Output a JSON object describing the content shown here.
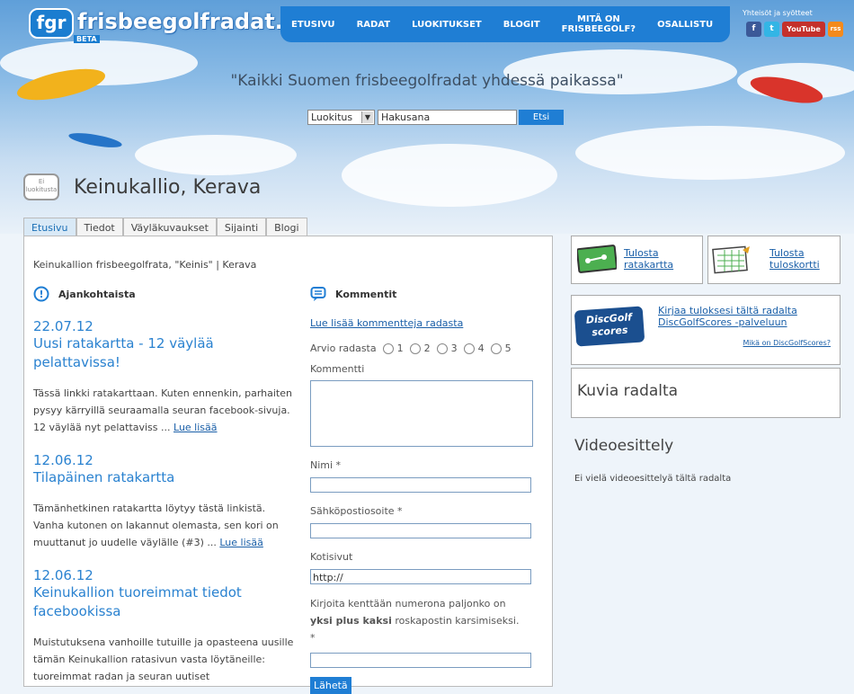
{
  "header": {
    "logo_short": "fgr",
    "logo_text": "frisbeegolfradat.fi",
    "logo_beta": "BETA",
    "nav": [
      "ETUSIVU",
      "RADAT",
      "LUOKITUKSET",
      "BLOGIT",
      "MITÄ ON\nFRISBEEGOLF?",
      "OSALLISTU"
    ],
    "social_title": "Yhteisöt ja syötteet",
    "social": [
      "f",
      "t",
      "YouTube",
      "rss"
    ],
    "tagline": "\"Kaikki Suomen frisbeegolfradat yhdessä paikassa\""
  },
  "search": {
    "select_value": "Luokitus",
    "input_placeholder": "Hakusana",
    "button": "Etsi"
  },
  "page": {
    "badge": "Ei luokitusta",
    "title": "Keinukallio, Kerava",
    "tabs": [
      "Etusivu",
      "Tiedot",
      "Väyläkuvaukset",
      "Sijainti",
      "Blogi"
    ],
    "breadcrumb": "Keinukallion frisbeegolfrata, \"Keinis\" | Kerava"
  },
  "news": {
    "heading": "Ajankohtaista",
    "read_more": "Lue lisää",
    "items": [
      {
        "date": "22.07.12",
        "title": "Uusi ratakartta - 12 väylää pelattavissa!",
        "body": "Tässä linkki ratakarttaan. Kuten ennenkin, parhaiten pysyy kärryillä seuraamalla seuran facebook-sivuja. 12 väylää nyt pelattaviss ... "
      },
      {
        "date": "12.06.12",
        "title": "Tilapäinen ratakartta",
        "body": "Tämänhetkinen ratakartta löytyy tästä linkistä. Vanha kutonen on lakannut olemasta, sen kori on muuttanut jo uudelle väylälle (#3) ... "
      },
      {
        "date": "12.06.12",
        "title": "Keinukallion tuoreimmat tiedot facebookissa",
        "body": "Muistutuksena vanhoille tutuille ja opasteena uusille tämän Keinukallion ratasivun vasta löytäneille: tuoreimmat radan ja seuran uutiset"
      }
    ]
  },
  "comments": {
    "heading": "Kommentit",
    "more_link": "Lue lisää kommentteja radasta",
    "rating_label": "Arvio radasta",
    "rating_options": [
      "1",
      "2",
      "3",
      "4",
      "5"
    ],
    "comment_label": "Kommentti",
    "name_label": "Nimi *",
    "email_label": "Sähköpostiosoite *",
    "website_label": "Kotisivut",
    "website_value": "http://",
    "captcha_pre": "Kirjoita kenttään numerona paljonko on ",
    "captcha_bold": "yksi plus kaksi",
    "captcha_post": " roskapostin karsimiseksi. *",
    "submit": "Lähetä"
  },
  "sidebar": {
    "print_map": "Tulosta ratakartta",
    "print_card": "Tulosta tuloskortti",
    "dgs_link": "Kirjaa tuloksesi tältä radalta DiscGolfScores -palveluun",
    "dgs_logo_1": "DiscGolf",
    "dgs_logo_2": "scores",
    "dgs_info": "Mikä on DiscGolfScores?",
    "photos_heading": "Kuvia radalta",
    "video_heading": "Videoesittely",
    "video_text": "Ei vielä videoesittelyä tältä radalta"
  },
  "colors": {
    "accent": "#1f7ed4",
    "link": "#1a5fa8",
    "heading_blue": "#2a82d0"
  }
}
